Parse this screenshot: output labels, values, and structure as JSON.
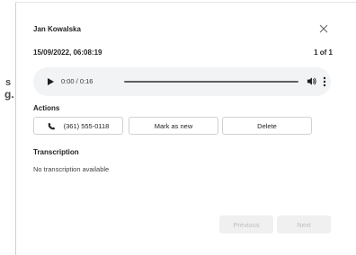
{
  "dialog": {
    "title": "Jan Kowalska",
    "close_icon": "close-icon",
    "date": "15/09/2022, 06:08:19",
    "count": "1 of 1"
  },
  "player": {
    "time": "0:00 / 0:16",
    "progress": 0,
    "icons": [
      "play-icon",
      "volume-icon",
      "more-vertical-icon"
    ]
  },
  "actions": {
    "heading": "Actions",
    "call_label": "(361) 555-0118",
    "mark_new_label": "Mark as new",
    "delete_label": "Delete"
  },
  "transcription": {
    "heading": "Transcription",
    "text": "No transcription available"
  },
  "navigation": {
    "previous_label": "Previous",
    "next_label": "Next"
  },
  "colors": {
    "player_bg": "#f1f3f4",
    "border": "#d1d1d1",
    "disabled_bg": "#f0f0f0",
    "disabled_text": "#bdbdbd"
  }
}
